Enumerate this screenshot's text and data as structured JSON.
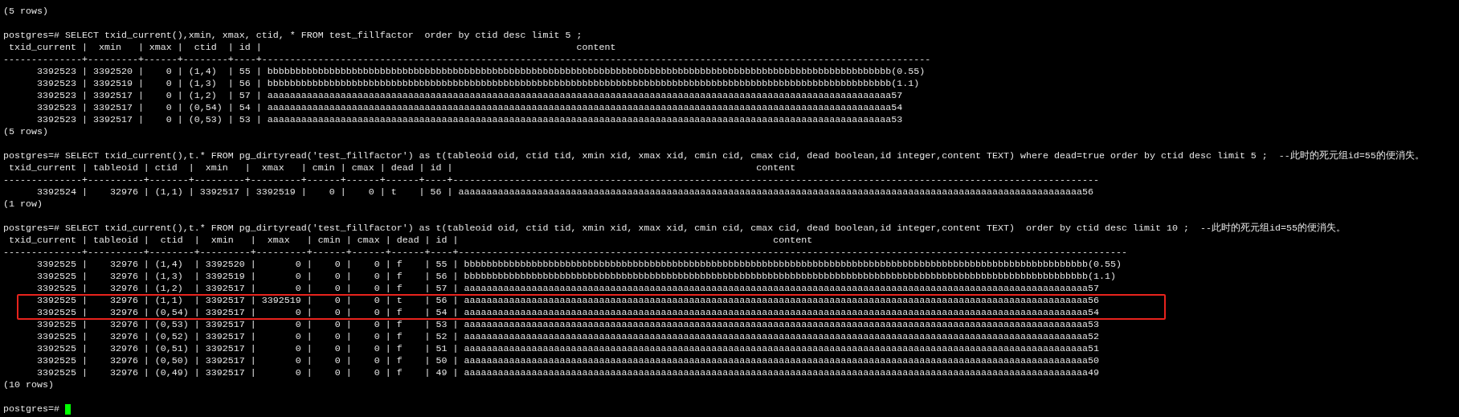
{
  "terminal": {
    "lines": [
      {
        "kind": "count",
        "text": "(5 rows)"
      },
      {
        "kind": "blank"
      },
      {
        "kind": "command",
        "text": "postgres=# SELECT txid_current(),xmin, xmax, ctid, * FROM test_fillfactor  order by ctid desc limit 5 ;"
      },
      {
        "kind": "header",
        "text": " txid_current |  xmin   | xmax |  ctid  | id |                                                        content"
      },
      {
        "kind": "separator",
        "text": "--------------+---------+------+--------+----+-----------------------------------------------------------------------------------------------------------------------"
      },
      {
        "kind": "row",
        "text": "      3392523 | 3392520 |    0 | (1,4)  | 55 | bbbbbbbbbbbbbbbbbbbbbbbbbbbbbbbbbbbbbbbbbbbbbbbbbbbbbbbbbbbbbbbbbbbbbbbbbbbbbbbbbbbbbbbbbbbbbbbbbbbbbbbbbbbbbbb(0.55)"
      },
      {
        "kind": "row",
        "text": "      3392523 | 3392519 |    0 | (1,3)  | 56 | bbbbbbbbbbbbbbbbbbbbbbbbbbbbbbbbbbbbbbbbbbbbbbbbbbbbbbbbbbbbbbbbbbbbbbbbbbbbbbbbbbbbbbbbbbbbbbbbbbbbbbbbbbbbbbb(1.1)"
      },
      {
        "kind": "row",
        "text": "      3392523 | 3392517 |    0 | (1,2)  | 57 | aaaaaaaaaaaaaaaaaaaaaaaaaaaaaaaaaaaaaaaaaaaaaaaaaaaaaaaaaaaaaaaaaaaaaaaaaaaaaaaaaaaaaaaaaaaaaaaaaaaaaaaaaaaaaaa57"
      },
      {
        "kind": "row",
        "text": "      3392523 | 3392517 |    0 | (0,54) | 54 | aaaaaaaaaaaaaaaaaaaaaaaaaaaaaaaaaaaaaaaaaaaaaaaaaaaaaaaaaaaaaaaaaaaaaaaaaaaaaaaaaaaaaaaaaaaaaaaaaaaaaaaaaaaaaaa54"
      },
      {
        "kind": "row",
        "text": "      3392523 | 3392517 |    0 | (0,53) | 53 | aaaaaaaaaaaaaaaaaaaaaaaaaaaaaaaaaaaaaaaaaaaaaaaaaaaaaaaaaaaaaaaaaaaaaaaaaaaaaaaaaaaaaaaaaaaaaaaaaaaaaaaaaaaaaaa53"
      },
      {
        "kind": "count",
        "text": "(5 rows)"
      },
      {
        "kind": "blank"
      },
      {
        "kind": "command",
        "text": "postgres=# SELECT txid_current(),t.* FROM pg_dirtyread('test_fillfactor') as t(tableoid oid, ctid tid, xmin xid, xmax xid, cmin cid, cmax cid, dead boolean,id integer,content TEXT) where dead=true order by ctid desc limit 5 ;  --此时的死元组id=55的便消失。"
      },
      {
        "kind": "header",
        "text": " txid_current | tableoid | ctid  |  xmin   |  xmax   | cmin | cmax | dead | id |                                                      content"
      },
      {
        "kind": "separator",
        "text": "--------------+----------+-------+---------+---------+------+------+------+----+-------------------------------------------------------------------------------------------------------------------"
      },
      {
        "kind": "row",
        "text": "      3392524 |    32976 | (1,1) | 3392517 | 3392519 |    0 |    0 | t    | 56 | aaaaaaaaaaaaaaaaaaaaaaaaaaaaaaaaaaaaaaaaaaaaaaaaaaaaaaaaaaaaaaaaaaaaaaaaaaaaaaaaaaaaaaaaaaaaaaaaaaaaaaaaaaaaaaa56"
      },
      {
        "kind": "count",
        "text": "(1 row)"
      },
      {
        "kind": "blank"
      },
      {
        "kind": "command",
        "text": "postgres=# SELECT txid_current(),t.* FROM pg_dirtyread('test_fillfactor') as t(tableoid oid, ctid tid, xmin xid, xmax xid, cmin cid, cmax cid, dead boolean,id integer,content TEXT)  order by ctid desc limit 10 ;  --此时的死元组id=55的便消失。"
      },
      {
        "kind": "header",
        "text": " txid_current | tableoid |  ctid  |  xmin   |  xmax   | cmin | cmax | dead | id |                                                        content"
      },
      {
        "kind": "separator",
        "text": "--------------+----------+--------+---------+---------+------+------+------+----+-----------------------------------------------------------------------------------------------------------------------"
      },
      {
        "kind": "row",
        "highlighted": false,
        "text": "      3392525 |    32976 | (1,4)  | 3392520 |       0 |    0 |    0 | f    | 55 | bbbbbbbbbbbbbbbbbbbbbbbbbbbbbbbbbbbbbbbbbbbbbbbbbbbbbbbbbbbbbbbbbbbbbbbbbbbbbbbbbbbbbbbbbbbbbbbbbbbbbbbbbbbbbbb(0.55)"
      },
      {
        "kind": "row",
        "highlighted": false,
        "text": "      3392525 |    32976 | (1,3)  | 3392519 |       0 |    0 |    0 | f    | 56 | bbbbbbbbbbbbbbbbbbbbbbbbbbbbbbbbbbbbbbbbbbbbbbbbbbbbbbbbbbbbbbbbbbbbbbbbbbbbbbbbbbbbbbbbbbbbbbbbbbbbbbbbbbbbbbb(1.1)"
      },
      {
        "kind": "row",
        "highlighted": false,
        "text": "      3392525 |    32976 | (1,2)  | 3392517 |       0 |    0 |    0 | f    | 57 | aaaaaaaaaaaaaaaaaaaaaaaaaaaaaaaaaaaaaaaaaaaaaaaaaaaaaaaaaaaaaaaaaaaaaaaaaaaaaaaaaaaaaaaaaaaaaaaaaaaaaaaaaaaaaaa57"
      },
      {
        "kind": "row",
        "highlighted": true,
        "text": "      3392525 |    32976 | (1,1)  | 3392517 | 3392519 |    0 |    0 | t    | 56 | aaaaaaaaaaaaaaaaaaaaaaaaaaaaaaaaaaaaaaaaaaaaaaaaaaaaaaaaaaaaaaaaaaaaaaaaaaaaaaaaaaaaaaaaaaaaaaaaaaaaaaaaaaaaaaa56"
      },
      {
        "kind": "row",
        "highlighted": true,
        "text": "      3392525 |    32976 | (0,54) | 3392517 |       0 |    0 |    0 | f    | 54 | aaaaaaaaaaaaaaaaaaaaaaaaaaaaaaaaaaaaaaaaaaaaaaaaaaaaaaaaaaaaaaaaaaaaaaaaaaaaaaaaaaaaaaaaaaaaaaaaaaaaaaaaaaaaaaa54"
      },
      {
        "kind": "row",
        "highlighted": false,
        "text": "      3392525 |    32976 | (0,53) | 3392517 |       0 |    0 |    0 | f    | 53 | aaaaaaaaaaaaaaaaaaaaaaaaaaaaaaaaaaaaaaaaaaaaaaaaaaaaaaaaaaaaaaaaaaaaaaaaaaaaaaaaaaaaaaaaaaaaaaaaaaaaaaaaaaaaaaa53"
      },
      {
        "kind": "row",
        "highlighted": false,
        "text": "      3392525 |    32976 | (0,52) | 3392517 |       0 |    0 |    0 | f    | 52 | aaaaaaaaaaaaaaaaaaaaaaaaaaaaaaaaaaaaaaaaaaaaaaaaaaaaaaaaaaaaaaaaaaaaaaaaaaaaaaaaaaaaaaaaaaaaaaaaaaaaaaaaaaaaaaa52"
      },
      {
        "kind": "row",
        "highlighted": false,
        "text": "      3392525 |    32976 | (0,51) | 3392517 |       0 |    0 |    0 | f    | 51 | aaaaaaaaaaaaaaaaaaaaaaaaaaaaaaaaaaaaaaaaaaaaaaaaaaaaaaaaaaaaaaaaaaaaaaaaaaaaaaaaaaaaaaaaaaaaaaaaaaaaaaaaaaaaaaa51"
      },
      {
        "kind": "row",
        "highlighted": false,
        "text": "      3392525 |    32976 | (0,50) | 3392517 |       0 |    0 |    0 | f    | 50 | aaaaaaaaaaaaaaaaaaaaaaaaaaaaaaaaaaaaaaaaaaaaaaaaaaaaaaaaaaaaaaaaaaaaaaaaaaaaaaaaaaaaaaaaaaaaaaaaaaaaaaaaaaaaaaa50"
      },
      {
        "kind": "row",
        "highlighted": false,
        "text": "      3392525 |    32976 | (0,49) | 3392517 |       0 |    0 |    0 | f    | 49 | aaaaaaaaaaaaaaaaaaaaaaaaaaaaaaaaaaaaaaaaaaaaaaaaaaaaaaaaaaaaaaaaaaaaaaaaaaaaaaaaaaaaaaaaaaaaaaaaaaaaaaaaaaaaaaa49"
      },
      {
        "kind": "count",
        "text": "(10 rows)"
      },
      {
        "kind": "blank"
      },
      {
        "kind": "prompt",
        "text": "postgres=#",
        "cursor": true
      }
    ]
  }
}
